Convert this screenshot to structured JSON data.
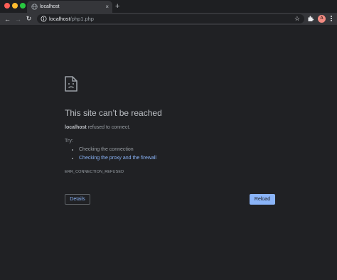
{
  "window": {
    "traffic_lights": [
      "close",
      "minimize",
      "maximize"
    ]
  },
  "tab": {
    "title": "localhost",
    "favicon": "globe-icon",
    "close_glyph": "×"
  },
  "new_tab_glyph": "+",
  "toolbar": {
    "back_glyph": "←",
    "forward_glyph": "→",
    "reload_glyph": "↻",
    "url_host": "localhost",
    "url_path": "/php1.php",
    "bookmark_glyph": "☆",
    "profile_initial": "A"
  },
  "error_page": {
    "heading": "This site can’t be reached",
    "host": "localhost",
    "message_suffix": " refused to connect.",
    "try_label": "Try:",
    "suggestions": [
      {
        "text": "Checking the connection",
        "is_link": false
      },
      {
        "text": "Checking the proxy and the firewall",
        "is_link": true
      }
    ],
    "error_code": "ERR_CONNECTION_REFUSED",
    "details_label": "Details",
    "reload_label": "Reload"
  },
  "colors": {
    "background": "#202124",
    "toolbar": "#35363a",
    "link": "#8ab4f8",
    "heading": "#bdc1c6",
    "body_text": "#9aa0a6"
  }
}
